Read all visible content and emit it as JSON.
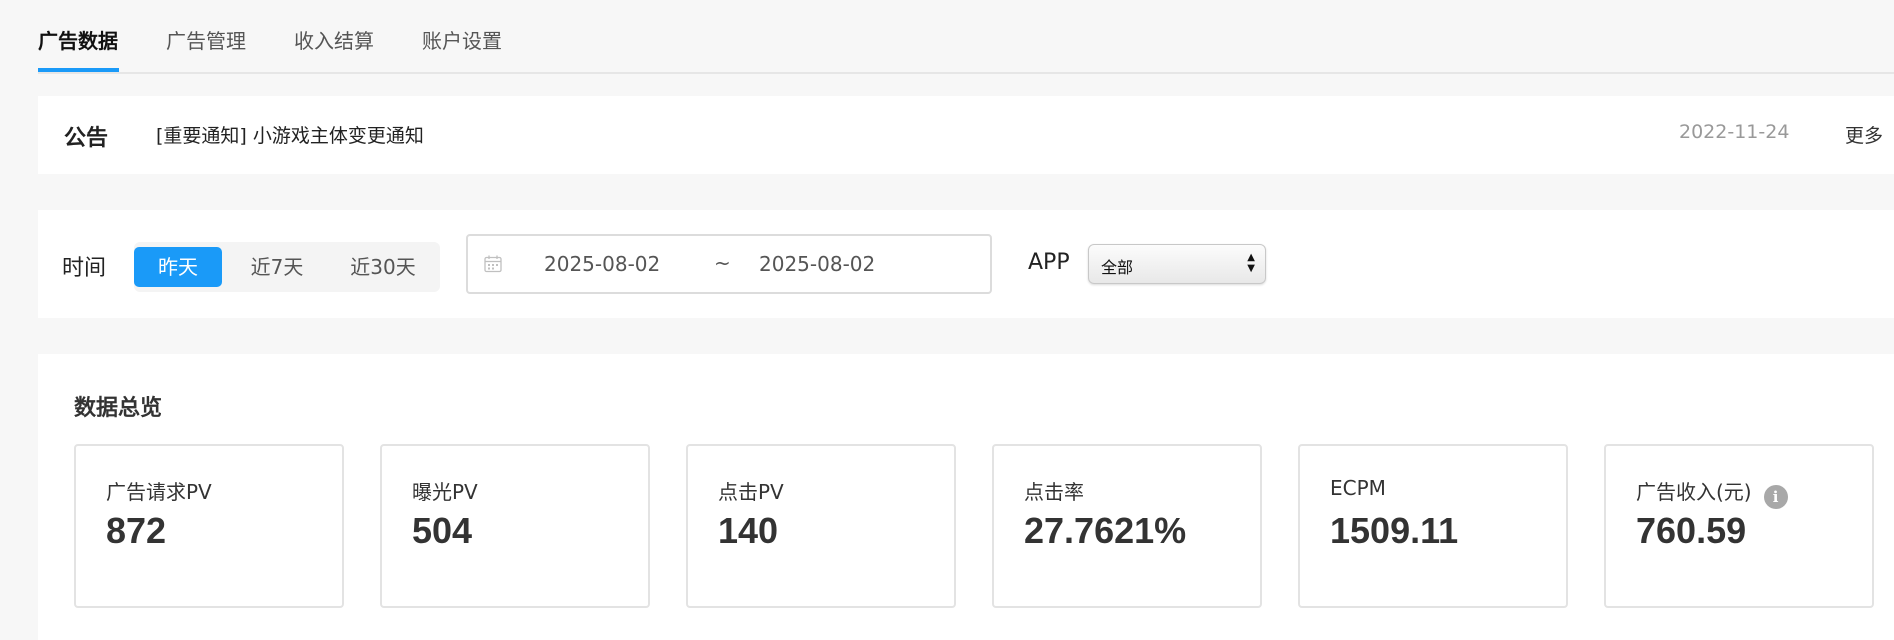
{
  "tabs": [
    {
      "label": "广告数据",
      "active": true
    },
    {
      "label": "广告管理"
    },
    {
      "label": "收入结算"
    },
    {
      "label": "账户设置"
    }
  ],
  "notice": {
    "title": "公告",
    "text": "[重要通知] 小游戏主体变更通知",
    "date": "2022-11-24",
    "more": "更多"
  },
  "filter": {
    "time_label": "时间",
    "ranges": [
      "昨天",
      "近7天",
      "近30天"
    ],
    "active_range": "昨天",
    "date_start": "2025-08-02",
    "date_sep": "~",
    "date_end": "2025-08-02",
    "app_label": "APP",
    "app_value": "全部"
  },
  "overview": {
    "title": "数据总览",
    "cards": [
      {
        "label": "广告请求PV",
        "value": "872"
      },
      {
        "label": "曝光PV",
        "value": "504"
      },
      {
        "label": "点击PV",
        "value": "140"
      },
      {
        "label": "点击率",
        "value": "27.7621%"
      },
      {
        "label": "ECPM",
        "value": "1509.11"
      },
      {
        "label": "广告收入(元)",
        "value": "760.59",
        "info_icon": "info-icon"
      }
    ]
  },
  "colors": {
    "accent": "#1a9af8",
    "background": "#f7f7f7",
    "panel": "#ffffff"
  }
}
